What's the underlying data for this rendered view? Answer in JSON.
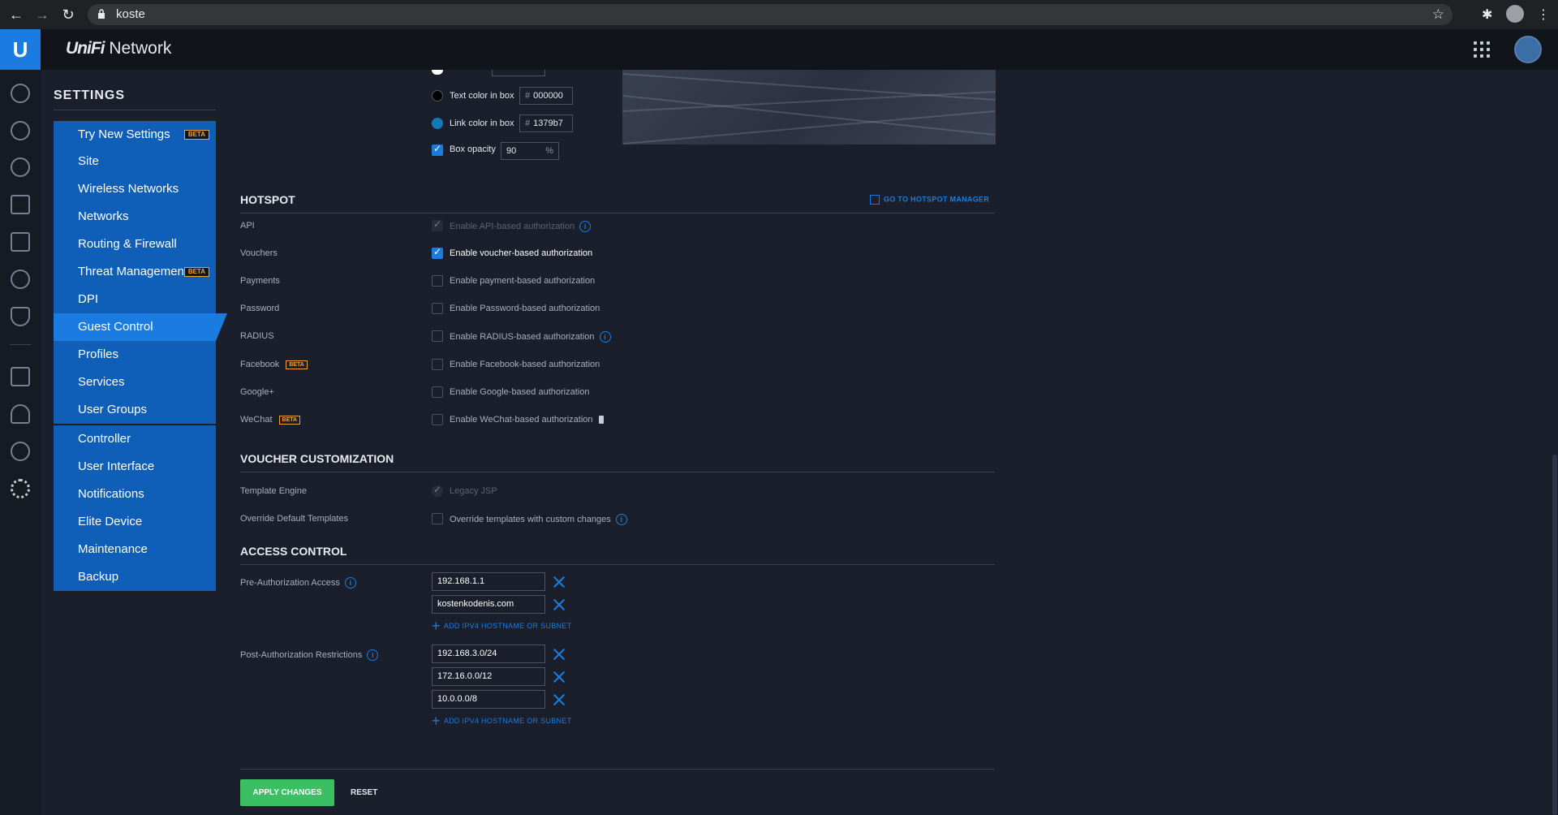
{
  "browser": {
    "url": "koste"
  },
  "app": {
    "brand_italic": "UniFi",
    "brand_rest": " Network",
    "logo": "U"
  },
  "settings": {
    "title": "SETTINGS"
  },
  "menu": {
    "try_new": {
      "label": "Try New Settings",
      "badge": "BETA"
    },
    "group1": [
      {
        "label": "Site"
      },
      {
        "label": "Wireless Networks"
      },
      {
        "label": "Networks"
      },
      {
        "label": "Routing & Firewall"
      },
      {
        "label": "Threat Management",
        "badge": "BETA"
      },
      {
        "label": "DPI"
      },
      {
        "label": "Guest Control",
        "active": true
      },
      {
        "label": "Profiles"
      },
      {
        "label": "Services"
      },
      {
        "label": "User Groups"
      }
    ],
    "group2": [
      {
        "label": "Controller"
      },
      {
        "label": "User Interface"
      },
      {
        "label": "Notifications"
      },
      {
        "label": "Elite Device"
      },
      {
        "label": "Maintenance"
      },
      {
        "label": "Backup"
      }
    ]
  },
  "colors": {
    "text_color_label": "Text color in box",
    "text_color_value": "000000",
    "link_color_label": "Link color in box",
    "link_color_value": "1379b7",
    "box_opacity_label": "Box opacity",
    "box_opacity_value": "90",
    "percent": "%",
    "hash": "#"
  },
  "hotspot": {
    "title": "HOTSPOT",
    "manager_link": "GO TO HOTSPOT MANAGER",
    "rows": [
      {
        "label": "API",
        "text": "Enable API-based authorization",
        "checked": true,
        "disabled": true
      },
      {
        "label": "Vouchers",
        "text": "Enable voucher-based authorization",
        "checked": true
      },
      {
        "label": "Payments",
        "text": "Enable payment-based authorization"
      },
      {
        "label": "Password",
        "text": "Enable Password-based authorization"
      },
      {
        "label": "RADIUS",
        "text": "Enable RADIUS-based authorization"
      },
      {
        "label": "Facebook",
        "text": "Enable Facebook-based authorization",
        "badge": "BETA"
      },
      {
        "label": "Google+",
        "text": "Enable Google-based authorization"
      },
      {
        "label": "WeChat",
        "text": "Enable WeChat-based authorization",
        "badge": "BETA"
      }
    ]
  },
  "voucher": {
    "title": "VOUCHER CUSTOMIZATION",
    "template_engine_label": "Template Engine",
    "template_engine_value": "Legacy JSP",
    "override_label": "Override Default Templates",
    "override_text": "Override templates with custom changes"
  },
  "access": {
    "title": "ACCESS CONTROL",
    "pre_label": "Pre-Authorization Access",
    "pre_entries": [
      "192.168.1.1",
      "kostenkodenis.com"
    ],
    "post_label": "Post-Authorization Restrictions",
    "post_entries": [
      "192.168.3.0/24",
      "172.16.0.0/12",
      "10.0.0.0/8"
    ],
    "add_label": "ADD IPV4 HOSTNAME OR SUBNET"
  },
  "actions": {
    "apply": "APPLY CHANGES",
    "reset": "RESET"
  }
}
